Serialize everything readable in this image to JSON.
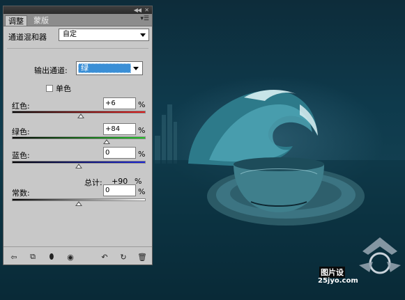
{
  "panel": {
    "tabs": [
      {
        "label": "调整"
      },
      {
        "label": "蒙版"
      }
    ],
    "preset_label": "通道混和器",
    "preset_value": "自定",
    "output_channel_label": "输出通道:",
    "output_channel_value": "绿",
    "monochrome_label": "单色",
    "sliders": [
      {
        "label": "红色:",
        "value": "+6",
        "unit": "%",
        "level": 6,
        "range": [
          -200,
          200
        ],
        "gradient": [
          "#000000",
          "#e11c1c"
        ]
      },
      {
        "label": "绿色:",
        "value": "+84",
        "unit": "%",
        "level": 84,
        "range": [
          -200,
          200
        ],
        "gradient": [
          "#000000",
          "#22c427"
        ]
      },
      {
        "label": "蓝色:",
        "value": "0",
        "unit": "%",
        "level": 0,
        "range": [
          -200,
          200
        ],
        "gradient": [
          "#000000",
          "#1b24d6"
        ]
      }
    ],
    "total_label": "总计:",
    "total_value": "+90",
    "total_unit": "%",
    "constant": {
      "label": "常数:",
      "value": "0",
      "unit": "%",
      "level": 0,
      "range": [
        -200,
        200
      ],
      "gradient": [
        "#000000",
        "#ffffff"
      ]
    },
    "bottom_icons": [
      "back-arrow-icon",
      "expand-view-icon",
      "clip-layer-icon",
      "visibility-eye-icon",
      "previous-state-icon",
      "reset-icon",
      "trash-icon"
    ]
  },
  "watermark": {
    "line1": "图片设",
    "line2": "25jyo.com"
  },
  "colors": {
    "selection_blue": "#3a8fd6",
    "panel_bg": "#c8c8c8",
    "sea_dark": "#0b2f3d"
  }
}
